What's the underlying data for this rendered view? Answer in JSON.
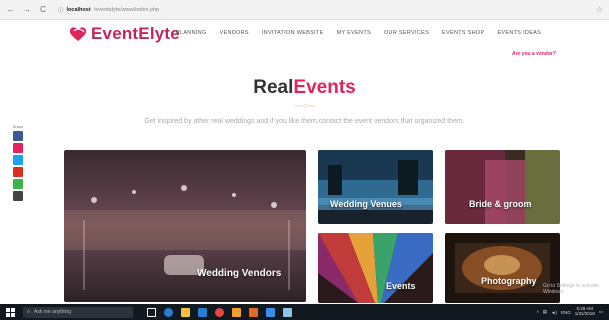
{
  "browser": {
    "back": "←",
    "forward": "→",
    "reload": "C",
    "host": "localhost",
    "path": "/eventelyte/www/index.php",
    "star": "☆"
  },
  "brand": {
    "name": "EventElyte"
  },
  "menu": [
    "PLANNING",
    "VENDORS",
    "INVITATION WEBSITE",
    "MY EVENTS",
    "OUR SERVICES",
    "EVENTS SHOP",
    "EVENTS IDEAS"
  ],
  "vendor_link": "Are you a vendor?",
  "hero": {
    "title_part1": "Real",
    "title_part2": "Events",
    "subtitle": "Get inspired by other real weddings and if you like them,contact the event vendors that organized them."
  },
  "sidebar": {
    "label": "Share",
    "colors": [
      "#3b5998",
      "#e0245e",
      "#1da1f2",
      "#d93025",
      "#3bb34a",
      "#444444"
    ]
  },
  "tiles": [
    {
      "label": "Wedding Vendors",
      "colors": [
        "#3a2a30",
        "#6b4a55",
        "#a37b6e",
        "#2b2226"
      ]
    },
    {
      "label": "Wedding Venues",
      "colors": [
        "#1b3852",
        "#2e6a91",
        "#5aa0c9",
        "#17222c"
      ]
    },
    {
      "label": "Bride & groom",
      "colors": [
        "#6a2a3e",
        "#a84a6a",
        "#7f8b4a",
        "#3a2a22"
      ]
    },
    {
      "label": "Events",
      "colors": [
        "#c23b3b",
        "#e6a23a",
        "#3aa36b",
        "#3a6bc2"
      ]
    },
    {
      "label": "Photography",
      "colors": [
        "#3a2618",
        "#a8602c",
        "#e3b066",
        "#1d140e"
      ]
    }
  ],
  "watermark": "Go to Settings to activate Windows.",
  "taskbar": {
    "search_placeholder": "Ask me anything",
    "tray_lang": "ENG",
    "time": "9:29 AM",
    "date": "1/31/2018"
  },
  "accent": "#e0245e"
}
